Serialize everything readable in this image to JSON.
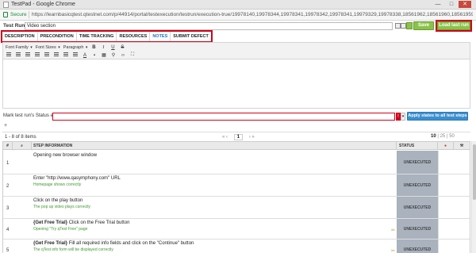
{
  "window": {
    "title": "TestPad - Google Chrome",
    "controls": [
      "—",
      "□",
      "✕"
    ]
  },
  "address": {
    "secure_label": "Secure",
    "url": "https://learnbasicqtest.qtestnet.com/p/44914/portal/testexecution/testrun/execution-true/19978140,19978344,19978341,19978342,19978341,19979329,19978338,18561962,18561960,18561959,18561956,185"
  },
  "run": {
    "label": "Test Run",
    "name_value": "Video section",
    "save_label": "Save",
    "load_last_label": "Load last run"
  },
  "tabs": [
    {
      "label": "DESCRIPTION"
    },
    {
      "label": "PRECONDITION"
    },
    {
      "label": "TIME TRACKING"
    },
    {
      "label": "RESOURCES"
    },
    {
      "label": "NOTES"
    },
    {
      "label": "SUBMIT DEFECT"
    }
  ],
  "toolbar": {
    "font_family": "Font Family",
    "font_sizes": "Font Sizes",
    "paragraph": "Paragraph",
    "bold": "B",
    "italic": "I",
    "underline": "U",
    "strike": "S",
    "font_color": "A",
    "code": "‹›",
    "fullscreen": "⛶"
  },
  "status": {
    "label": "Mark test run's Status as",
    "value": "",
    "warn": "!",
    "apply_label": "Apply states to all test steps"
  },
  "pager": {
    "items_text": "1 - 8 of 8 items",
    "current_page": "1",
    "sizes": [
      "10",
      "25",
      "50"
    ],
    "selected_size": "10"
  },
  "grid": {
    "headers": {
      "num": "#",
      "step": "STEP INFORMATION",
      "status": "STATUS"
    },
    "rows": [
      {
        "num": "1",
        "prefix": "",
        "step": "Opening new browser window",
        "expected": "",
        "status": "UNEXECUTED",
        "attach": false
      },
      {
        "num": "2",
        "prefix": "",
        "step": "Enter \"http://www.qasymphony.com\" URL",
        "expected": "Homepage shows correctly",
        "status": "UNEXECUTED",
        "attach": false
      },
      {
        "num": "3",
        "prefix": "",
        "step": "Click on the play button",
        "expected": "The pop up video plays correctly",
        "status": "UNEXECUTED",
        "attach": false
      },
      {
        "num": "4",
        "prefix": "{Get Free Trial}",
        "step": " Click on the Free Trial button",
        "expected": "Opening \"Try qTest Free\" page",
        "status": "UNEXECUTED",
        "attach": true
      },
      {
        "num": "5",
        "prefix": "{Get Free Trial}",
        "step": " Fill all required info fields and click on the \"Continue\" button",
        "expected": "The qTest info form will be displayed correctly",
        "status": "UNEXECUTED",
        "attach": true
      }
    ]
  }
}
